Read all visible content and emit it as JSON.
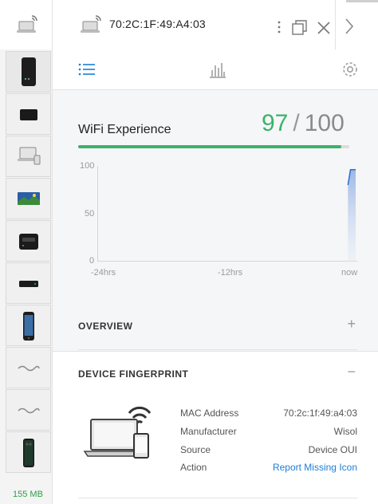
{
  "window": {
    "title": "70:2C:1F:49:A4:03",
    "memory": "155 MB"
  },
  "toolbar": {
    "tabs": [
      {
        "name": "list-icon",
        "active": true
      },
      {
        "name": "stats-icon",
        "active": false
      },
      {
        "name": "gear-icon",
        "active": false
      }
    ],
    "accent": "#1c7ed6"
  },
  "sidebar": {
    "items": [
      {
        "icon": "black-tower-device-icon",
        "selected": true
      },
      {
        "icon": "small-black-device-icon"
      },
      {
        "icon": "laptop-icon"
      },
      {
        "icon": "landscape-photo-device-icon"
      },
      {
        "icon": "black-box-device-icon"
      },
      {
        "icon": "black-flat-device-icon"
      },
      {
        "icon": "smartphone-icon"
      },
      {
        "icon": "wave-icon"
      },
      {
        "icon": "wave-icon"
      },
      {
        "icon": "dark-smartphone-icon"
      }
    ]
  },
  "wifi": {
    "title": "WiFi Experience",
    "score": "97",
    "separator": "/",
    "max": "100",
    "score_fraction": 0.97,
    "score_color": "#3bb26b"
  },
  "chart_data": {
    "type": "area",
    "y_ticks": [
      "100",
      "50",
      "0"
    ],
    "x_ticks": [
      "-24hrs",
      "-12hrs",
      "now"
    ],
    "ylim": [
      0,
      100
    ],
    "series": [
      {
        "x": [
          0.97,
          0.98,
          0.99,
          1.0
        ],
        "values": [
          80,
          96,
          96,
          96
        ]
      }
    ]
  },
  "sections": {
    "overview": {
      "label": "OVERVIEW",
      "toggle": "+"
    },
    "fingerprint": {
      "label": "DEVICE FINGERPRINT",
      "toggle": "−"
    }
  },
  "fingerprint": {
    "rows": [
      {
        "key": "MAC Address",
        "value": "70:2c:1f:49:a4:03"
      },
      {
        "key": "Manufacturer",
        "value": "Wisol"
      },
      {
        "key": "Source",
        "value": "Device OUI"
      },
      {
        "key": "Action",
        "value": "Report Missing Icon"
      }
    ]
  }
}
